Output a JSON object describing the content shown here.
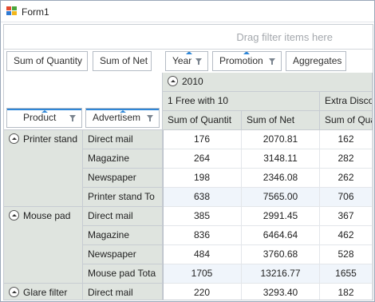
{
  "window": {
    "title": "Form1"
  },
  "filter_area": {
    "hint": "Drag filter items here"
  },
  "data_fields": [
    {
      "label": "Sum of Quantity"
    },
    {
      "label": "Sum of Net"
    }
  ],
  "column_fields": [
    {
      "label": "Year"
    },
    {
      "label": "Promotion"
    },
    {
      "label": "Aggregates"
    }
  ],
  "row_fields": [
    {
      "label": "Product"
    },
    {
      "label": "Advertisem"
    }
  ],
  "column_header": {
    "year": "2010",
    "promotions": [
      "1 Free with 10",
      "Extra Discou"
    ],
    "measures": [
      "Sum of Quantit",
      "Sum of Net",
      "Sum of Qua"
    ]
  },
  "rows": [
    {
      "product": "Printer stand",
      "channel": "Direct mail",
      "values": [
        "176",
        "2070.81",
        "162"
      ]
    },
    {
      "channel": "Magazine",
      "values": [
        "264",
        "3148.11",
        "282"
      ]
    },
    {
      "channel": "Newspaper",
      "values": [
        "198",
        "2346.08",
        "262"
      ]
    },
    {
      "channel": "Printer stand To",
      "values": [
        "638",
        "7565.00",
        "706"
      ],
      "total": true
    },
    {
      "product": "Mouse pad",
      "channel": "Direct mail",
      "values": [
        "385",
        "2991.45",
        "367"
      ]
    },
    {
      "channel": "Magazine",
      "values": [
        "836",
        "6464.64",
        "462"
      ]
    },
    {
      "channel": "Newspaper",
      "values": [
        "484",
        "3760.68",
        "528"
      ]
    },
    {
      "channel": "Mouse pad Tota",
      "values": [
        "1705",
        "13216.77",
        "1655"
      ],
      "total": true
    },
    {
      "product": "Glare filter",
      "channel": "Direct mail",
      "values": [
        "220",
        "3293.40",
        "182"
      ]
    }
  ],
  "colors": {
    "accent": "#2f87d8",
    "header_bg": "#dfe4df",
    "total_bg": "#f0f5fb"
  },
  "icons": {
    "app": "form-icon",
    "collapse": "collapse-up-icon",
    "filter": "filter-funnel-icon"
  }
}
